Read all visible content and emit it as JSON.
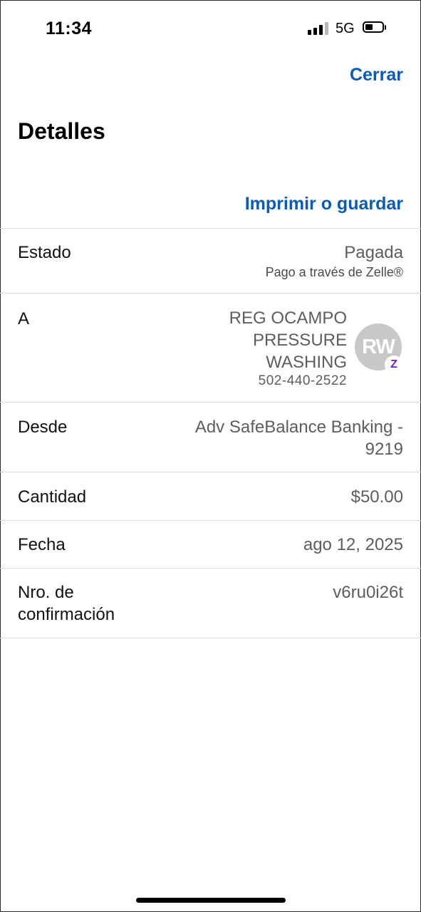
{
  "status_bar": {
    "time": "11:34",
    "network": "5G"
  },
  "header": {
    "close_label": "Cerrar",
    "title": "Detalles",
    "print_label": "Imprimir o guardar"
  },
  "rows": {
    "estado": {
      "label": "Estado",
      "value": "Pagada",
      "sub": "Pago a través de Zelle®"
    },
    "a": {
      "label": "A",
      "name": "REG OCAMPO PRESSURE WASHING",
      "phone": "502-440-2522",
      "avatar_initials": "RW",
      "badge_icon": "zelle-icon",
      "badge_glyph": "Z"
    },
    "desde": {
      "label": "Desde",
      "value_line1": "Adv SafeBalance Banking -",
      "value_line2": "9219"
    },
    "cantidad": {
      "label": "Cantidad",
      "value": "$50.00"
    },
    "fecha": {
      "label": "Fecha",
      "value": "ago 12, 2025"
    },
    "confirmacion": {
      "label_line1": "Nro. de",
      "label_line2": "confirmación",
      "value": "v6ru0i26t"
    }
  },
  "colors": {
    "accent": "#0a5bb8",
    "zelle": "#6d1ed4",
    "avatar_bg": "#c8c8c8"
  }
}
